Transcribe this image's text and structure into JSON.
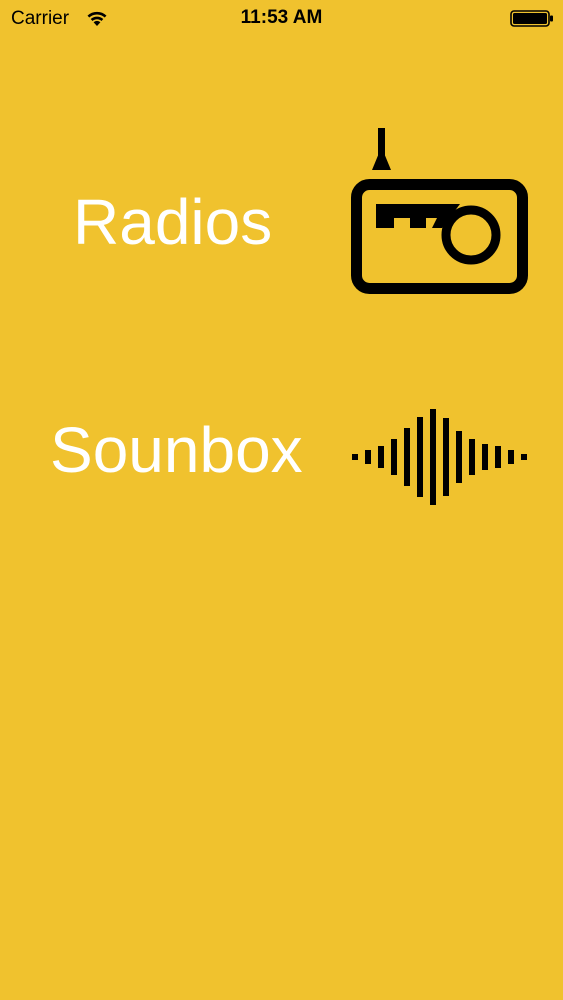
{
  "status_bar": {
    "carrier": "Carrier",
    "time": "11:53 AM",
    "wifi_icon": "wifi-icon",
    "battery_icon": "battery-icon"
  },
  "menu": {
    "items": [
      {
        "label": "Radios",
        "icon": "radio-icon"
      },
      {
        "label": "Sounbox",
        "icon": "soundwave-icon"
      }
    ]
  },
  "colors": {
    "background": "#F0C22E",
    "label": "#FFFFFF",
    "icon": "#000000"
  }
}
